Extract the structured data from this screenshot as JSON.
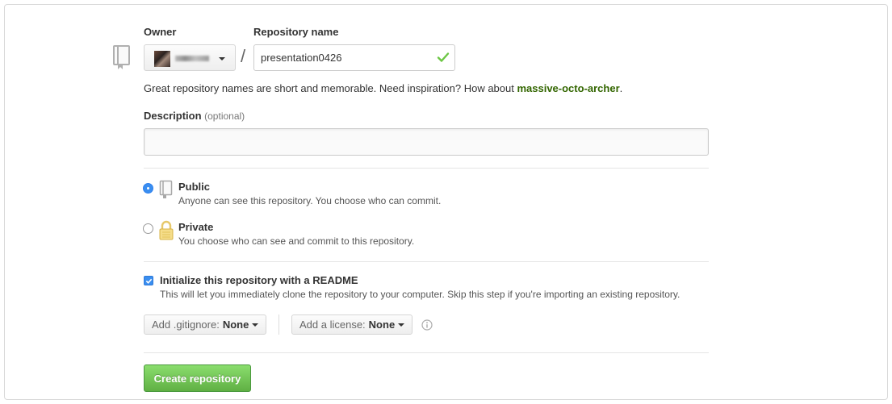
{
  "owner": {
    "label": "Owner"
  },
  "repo": {
    "label": "Repository name",
    "value": "presentation0426",
    "separator": "/"
  },
  "hint": {
    "text": "Great repository names are short and memorable. Need inspiration? How about ",
    "suggestion": "massive-octo-archer",
    "end": "."
  },
  "description": {
    "label": "Description",
    "optional": "(optional)",
    "value": ""
  },
  "visibility": {
    "public": {
      "title": "Public",
      "note": "Anyone can see this repository. You choose who can commit.",
      "selected": true
    },
    "private": {
      "title": "Private",
      "note": "You choose who can see and commit to this repository.",
      "selected": false
    }
  },
  "init": {
    "checked": true,
    "title": "Initialize this repository with a README",
    "note": "This will let you immediately clone the repository to your computer. Skip this step if you're importing an existing repository."
  },
  "gitignore": {
    "label": "Add .gitignore:",
    "value": "None"
  },
  "license": {
    "label": "Add a license:",
    "value": "None"
  },
  "create_button": "Create repository",
  "colors": {
    "accent_green": "#6cc644",
    "suggestion_green": "#336600",
    "radio_blue": "#3a8ef0"
  },
  "icons": [
    "repo-icon",
    "check-icon",
    "lock-icon",
    "info-icon",
    "caret-down-icon"
  ]
}
